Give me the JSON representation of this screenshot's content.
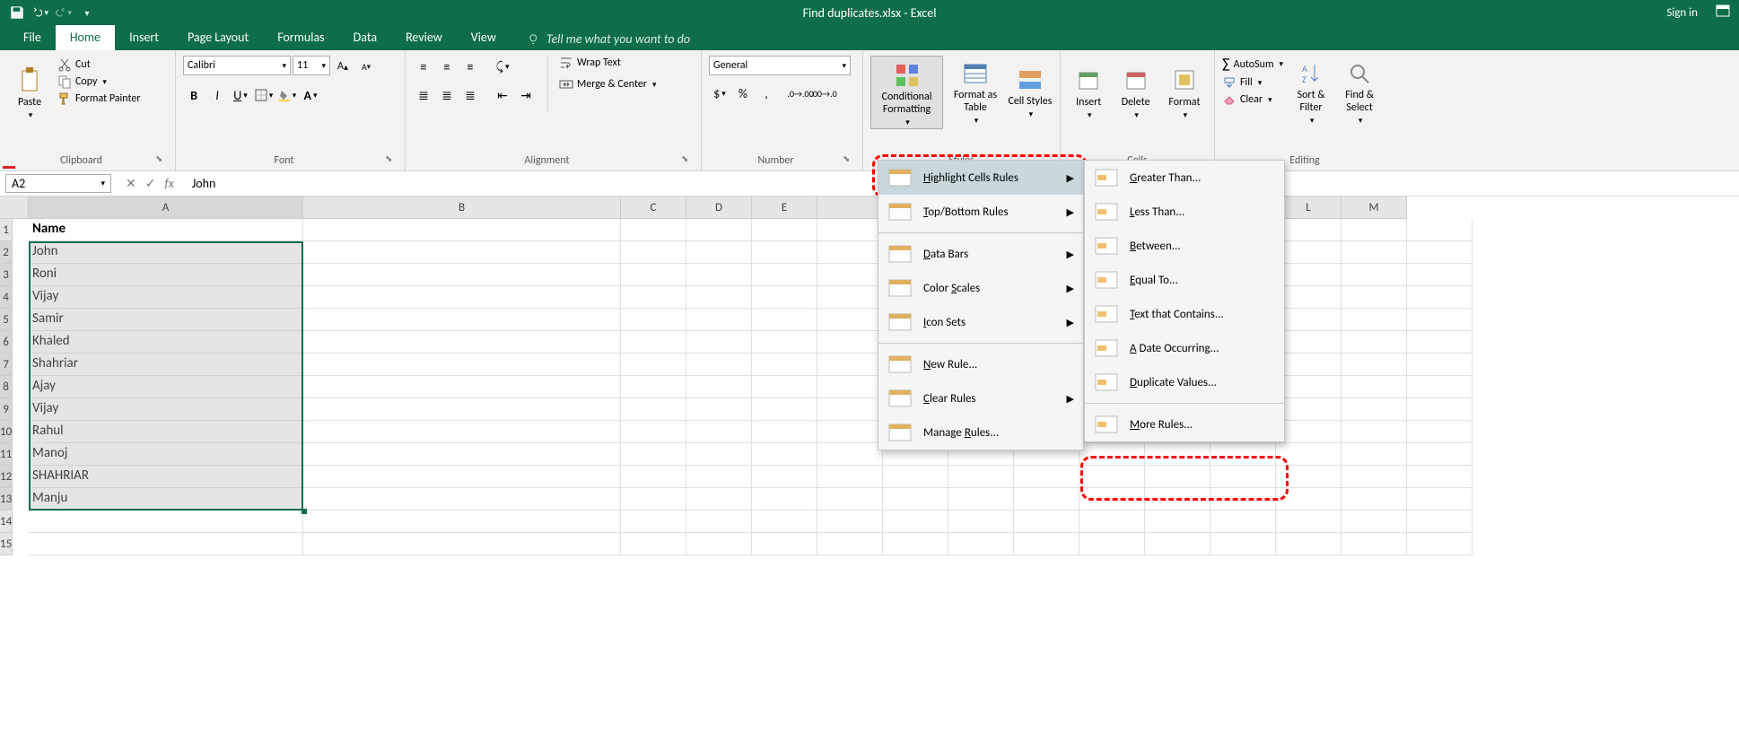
{
  "title": "Find duplicates.xlsx - Excel",
  "signin": "Sign in",
  "tabs": [
    "File",
    "Home",
    "Insert",
    "Page Layout",
    "Formulas",
    "Data",
    "Review",
    "View"
  ],
  "tellme": "Tell me what you want to do",
  "clipboard": {
    "label": "Clipboard",
    "paste": "Paste",
    "cut": "Cut",
    "copy": "Copy",
    "painter": "Format Painter"
  },
  "font": {
    "label": "Font",
    "name": "Calibri",
    "size": "11"
  },
  "alignment": {
    "label": "Alignment",
    "wrap": "Wrap Text",
    "merge": "Merge & Center"
  },
  "number": {
    "label": "Number",
    "format": "General"
  },
  "styles": {
    "label": "Styles",
    "cond": "Conditional Formatting",
    "table": "Format as Table",
    "cell": "Cell Styles"
  },
  "cells_grp": {
    "label": "Cells",
    "insert": "Insert",
    "delete": "Delete",
    "format": "Format"
  },
  "editing": {
    "label": "Editing",
    "autosum": "AutoSum",
    "fill": "Fill",
    "clear": "Clear",
    "sort": "Sort & Filter",
    "find": "Find & Select"
  },
  "namebox": "A2",
  "formula": "John",
  "columns": [
    "A",
    "B",
    "C",
    "D",
    "E",
    "",
    "",
    "",
    "",
    "",
    "",
    "",
    "L",
    "M"
  ],
  "rows": [
    {
      "a": "Name",
      "bold": true
    },
    {
      "a": "John"
    },
    {
      "a": "Roni"
    },
    {
      "a": "Vijay"
    },
    {
      "a": "Samir"
    },
    {
      "a": "Khaled"
    },
    {
      "a": "Shahriar"
    },
    {
      "a": "Ajay"
    },
    {
      "a": "Vijay"
    },
    {
      "a": "Rahul"
    },
    {
      "a": "Manoj"
    },
    {
      "a": "SHAHRIAR"
    },
    {
      "a": "Manju"
    },
    {
      "a": ""
    },
    {
      "a": ""
    }
  ],
  "menu1": {
    "items": [
      {
        "label": "Highlight Cells Rules",
        "sub": true,
        "hl": true,
        "ul": "H"
      },
      {
        "label": "Top/Bottom Rules",
        "sub": true,
        "ul": "T"
      },
      {
        "label": "Data Bars",
        "sub": true,
        "ul": "D",
        "sep_before": true
      },
      {
        "label": "Color Scales",
        "sub": true,
        "ul": "S"
      },
      {
        "label": "Icon Sets",
        "sub": true,
        "ul": "I"
      },
      {
        "label": "New Rule...",
        "ul": "N",
        "sep_before": true
      },
      {
        "label": "Clear Rules",
        "sub": true,
        "ul": "C"
      },
      {
        "label": "Manage Rules...",
        "ul": "R"
      }
    ]
  },
  "menu2": {
    "items": [
      {
        "label": "Greater Than...",
        "ul": "G"
      },
      {
        "label": "Less Than...",
        "ul": "L"
      },
      {
        "label": "Between...",
        "ul": "B"
      },
      {
        "label": "Equal To...",
        "ul": "E"
      },
      {
        "label": "Text that Contains...",
        "ul": "T"
      },
      {
        "label": "A Date Occurring...",
        "ul": "A"
      },
      {
        "label": "Duplicate Values...",
        "ul": "D"
      },
      {
        "label": "More Rules...",
        "ul": "M",
        "sep_before": true
      }
    ]
  }
}
